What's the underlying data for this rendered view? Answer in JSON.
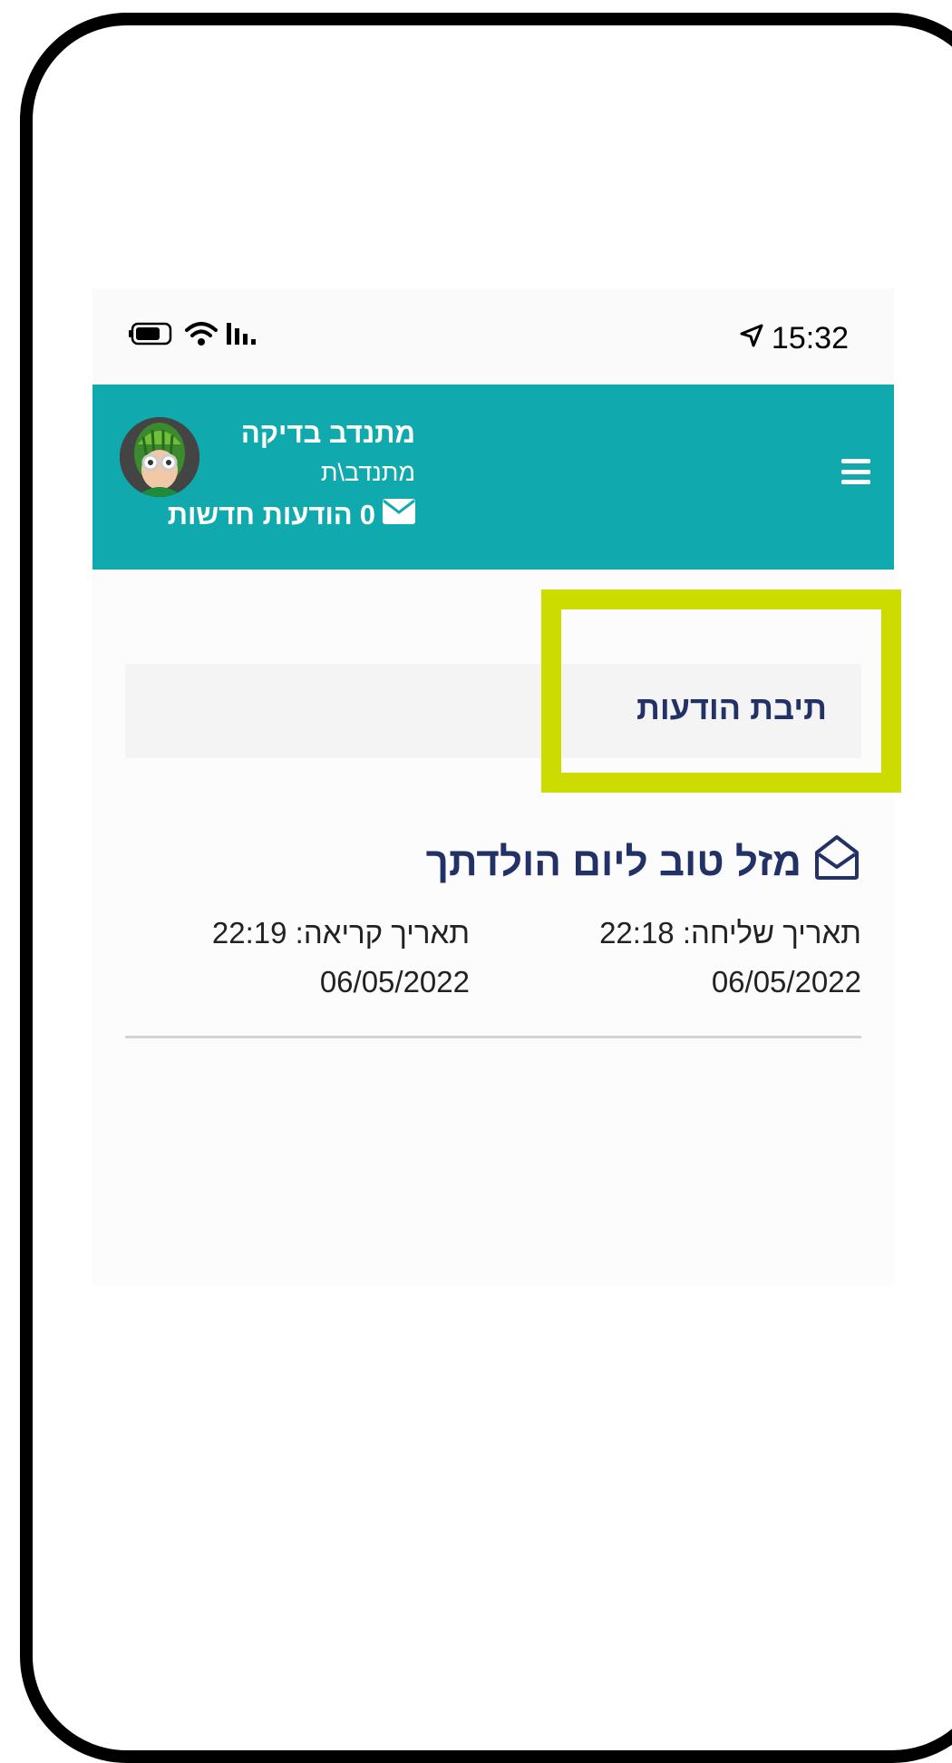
{
  "status_bar": {
    "time": "15:32",
    "icons": [
      "location-arrow-icon",
      "signal-icon",
      "wifi-icon",
      "battery-icon"
    ]
  },
  "header": {
    "background_color": "#10a9ad",
    "user_name": "מתנדב בדיקה",
    "user_role": "מתנדב\\ת",
    "messages_count": "0",
    "messages_label": "הודעות חדשות",
    "icons": [
      "menu-icon",
      "envelope-icon",
      "avatar"
    ]
  },
  "inbox": {
    "title": "תיבת הודעות"
  },
  "messages": [
    {
      "title": "מזל טוב ליום הולדתך",
      "icon": "envelope-open-icon",
      "sent_label": "תאריך שליחה: 22:18",
      "sent_date": "06/05/2022",
      "read_label": "תאריך קריאה: 22:19",
      "read_date": "06/05/2022"
    }
  ],
  "colors": {
    "accent": "#10a9ad",
    "title_text": "#233266",
    "highlight": "#cddc00"
  }
}
